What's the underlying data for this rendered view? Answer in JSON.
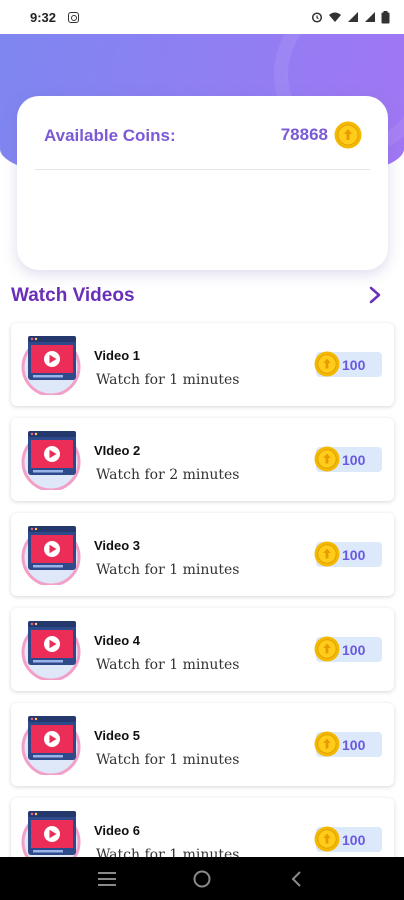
{
  "status_bar": {
    "time": "9:32",
    "icons": [
      "instagram-icon",
      "alarm-icon",
      "wifi-icon",
      "signal-icon",
      "signal-icon",
      "battery-icon"
    ]
  },
  "coins": {
    "label": "Available Coins:",
    "value": "78868",
    "icon": "coin-icon"
  },
  "section": {
    "title": "Watch Videos",
    "arrow_icon": "chevron-right-icon"
  },
  "videos": [
    {
      "title": "Video 1",
      "subtitle": "Watch for 1 minutes",
      "reward": "100"
    },
    {
      "title": "VIdeo 2",
      "subtitle": "Watch for 2 minutes",
      "reward": "100"
    },
    {
      "title": "Video 3",
      "subtitle": "Watch for 1 minutes",
      "reward": "100"
    },
    {
      "title": "Video 4",
      "subtitle": "Watch for 1 minutes",
      "reward": "100"
    },
    {
      "title": "Video 5",
      "subtitle": "Watch for 1 minutes",
      "reward": "100"
    },
    {
      "title": "Video 6",
      "subtitle": "Watch for 1 minutes",
      "reward": "100"
    }
  ],
  "nav": {
    "icons": [
      "menu-icon",
      "home-icon",
      "back-icon"
    ]
  },
  "colors": {
    "accent": "#7a5ad6",
    "header_gradient_start": "#7e86f0",
    "header_gradient_end": "#a176f4",
    "section_title": "#6a2fb8",
    "reward_bg": "#dce9fb",
    "coin": "#f5b800"
  }
}
